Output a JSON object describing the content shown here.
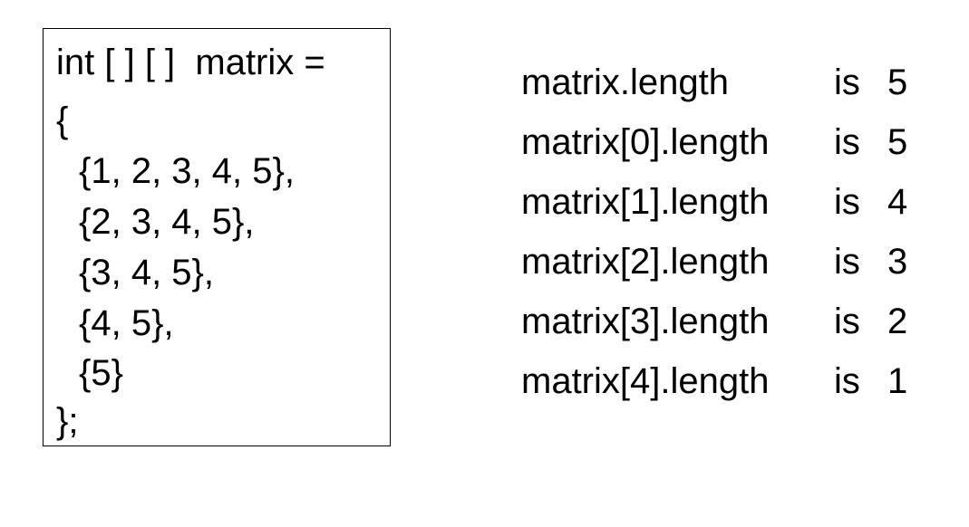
{
  "code": {
    "lines": [
      {
        "text": "int [ ] [ ]  matrix =",
        "indent": false
      },
      {
        "text": "{",
        "indent": false
      },
      {
        "text": "{1, 2, 3, 4, 5},",
        "indent": true
      },
      {
        "text": "{2, 3, 4, 5},",
        "indent": true
      },
      {
        "text": "{3, 4, 5},",
        "indent": true
      },
      {
        "text": "{4, 5},",
        "indent": true
      },
      {
        "text": "{5}",
        "indent": true
      },
      {
        "text": "};",
        "indent": false
      }
    ]
  },
  "lengths": [
    {
      "expr": "matrix.length",
      "is": "is",
      "value": "5"
    },
    {
      "expr": "matrix[0].length",
      "is": "is",
      "value": "5"
    },
    {
      "expr": "matrix[1].length",
      "is": "is",
      "value": "4"
    },
    {
      "expr": "matrix[2].length",
      "is": "is",
      "value": "3"
    },
    {
      "expr": "matrix[3].length",
      "is": "is",
      "value": "2"
    },
    {
      "expr": "matrix[4].length",
      "is": "is",
      "value": "1"
    }
  ]
}
